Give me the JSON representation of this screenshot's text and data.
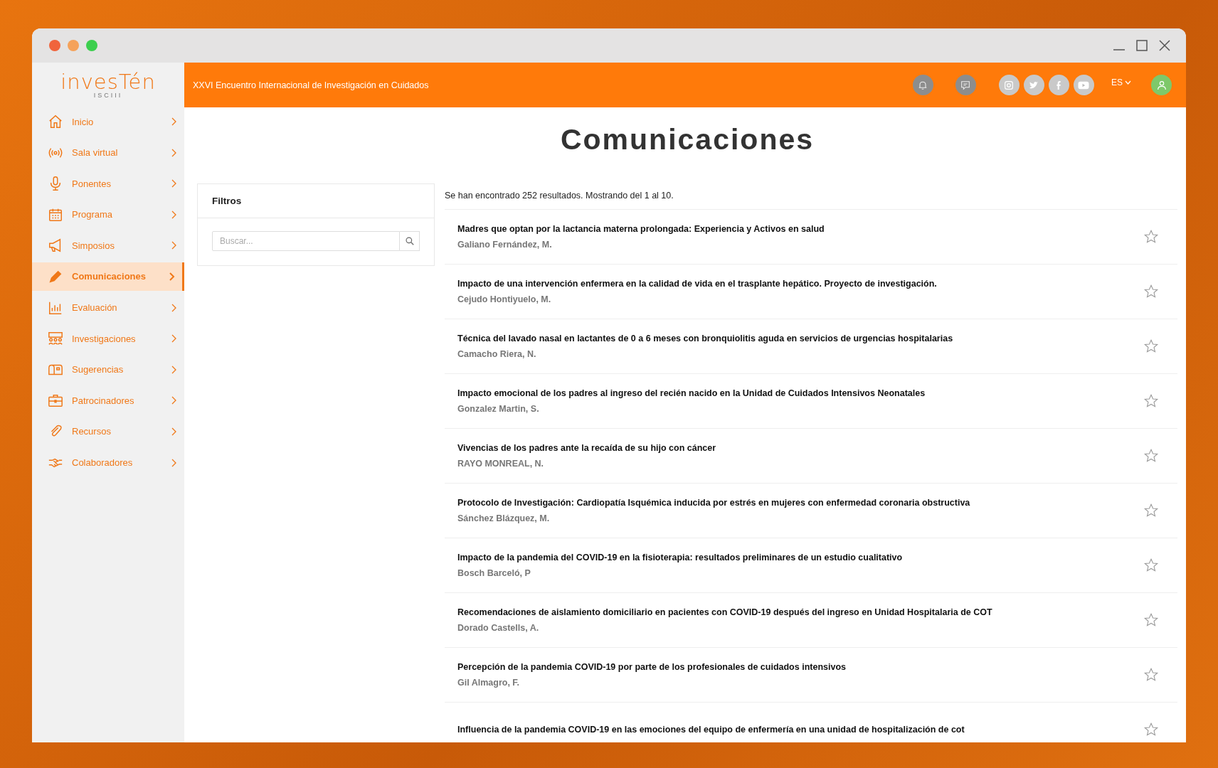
{
  "logo": {
    "name": "invesTén",
    "subtitle": "ISCIII"
  },
  "header": {
    "title": "XXVI Encuentro Internacional de Investigación en Cuidados",
    "language": "ES"
  },
  "sidebar": {
    "items": [
      {
        "label": "Inicio",
        "selected": false
      },
      {
        "label": "Sala virtual",
        "selected": false
      },
      {
        "label": "Ponentes",
        "selected": false
      },
      {
        "label": "Programa",
        "selected": false
      },
      {
        "label": "Simposios",
        "selected": false
      },
      {
        "label": "Comunicaciones",
        "selected": true
      },
      {
        "label": "Evaluación",
        "selected": false
      },
      {
        "label": "Investigaciones",
        "selected": false
      },
      {
        "label": "Sugerencias",
        "selected": false
      },
      {
        "label": "Patrocinadores",
        "selected": false
      },
      {
        "label": "Recursos",
        "selected": false
      },
      {
        "label": "Colaboradores",
        "selected": false
      }
    ]
  },
  "page": {
    "title": "Comunicaciones"
  },
  "filters": {
    "title": "Filtros",
    "search": {
      "placeholder": "Buscar..."
    }
  },
  "results": {
    "summary": "Se han encontrado 252 resultados. Mostrando del 1 al 10.",
    "items": [
      {
        "title": "Madres que optan por la lactancia materna prolongada: Experiencia y Activos en salud",
        "author": "Galiano Fernández, M.",
        "favorite": false
      },
      {
        "title": "Impacto de una intervención enfermera en la calidad de vida en el trasplante hepático. Proyecto de investigación.",
        "author": "Cejudo Hontiyuelo, M.",
        "favorite": false
      },
      {
        "title": "Técnica del lavado nasal en lactantes de 0 a 6 meses con bronquiolitis aguda en servicios de urgencias hospitalarias",
        "author": "Camacho Riera, N.",
        "favorite": false
      },
      {
        "title": "Impacto emocional de los padres al ingreso del recién nacido en la Unidad de Cuidados Intensivos Neonatales",
        "author": "Gonzalez Martin, S.",
        "favorite": false
      },
      {
        "title": "Vivencias de los padres ante la recaída de su hijo con cáncer",
        "author": "RAYO MONREAL, N.",
        "favorite": false
      },
      {
        "title": "Protocolo de Investigación: Cardiopatía Isquémica inducida por estrés en mujeres con enfermedad coronaria obstructiva",
        "author": "Sánchez Blázquez, M.",
        "favorite": false
      },
      {
        "title": "Impacto de la pandemia del COVID-19 en la fisioterapia: resultados preliminares de un estudio cualitativo",
        "author": "Bosch Barceló, P",
        "favorite": false
      },
      {
        "title": "Recomendaciones de aislamiento domiciliario en pacientes con COVID-19 después del ingreso en Unidad Hospitalaria de COT",
        "author": "Dorado Castells, A.",
        "favorite": false
      },
      {
        "title": "Percepción de la pandemia COVID-19 por parte de los profesionales de cuidados intensivos",
        "author": "Gil Almagro, F.",
        "favorite": false
      },
      {
        "title": "Influencia de la pandemia COVID-19 en las emociones del equipo de enfermería en una unidad de hospitalización de cot",
        "favorite": false
      }
    ]
  }
}
